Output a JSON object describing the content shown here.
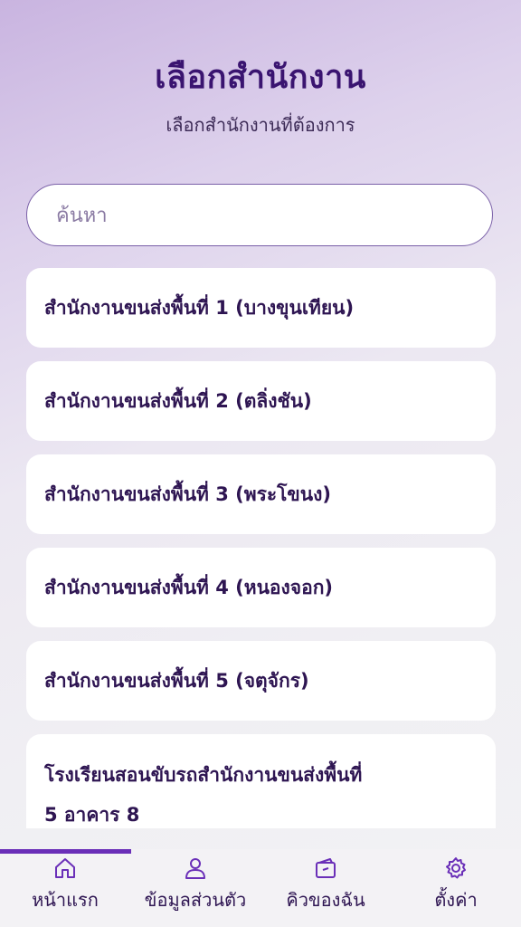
{
  "header": {
    "title": "เลือกสำนักงาน",
    "subtitle": "เลือกสำนักงานที่ต้องการ"
  },
  "search": {
    "placeholder": "ค้นหา",
    "value": ""
  },
  "offices": [
    {
      "label": "สำนักงานขนส่งพื้นที่ 1 (บางขุนเทียน)"
    },
    {
      "label": "สำนักงานขนส่งพื้นที่ 2 (ตลิ่งชัน)"
    },
    {
      "label": "สำนักงานขนส่งพื้นที่ 3 (พระโขนง)"
    },
    {
      "label": "สำนักงานขนส่งพื้นที่ 4 (หนองจอก)"
    },
    {
      "label": "สำนักงานขนส่งพื้นที่ 5 (จตุจักร)"
    },
    {
      "label_line1": "โรงเรียนสอนขับรถสำนักงานขนส่งพื้นที่",
      "label_line2": "5 อาคาร 8"
    }
  ],
  "nav": {
    "items": [
      {
        "label": "หน้าแรก",
        "icon": "home-icon",
        "active": true
      },
      {
        "label": "ข้อมูลส่วนตัว",
        "icon": "user-icon",
        "active": false
      },
      {
        "label": "คิวของฉัน",
        "icon": "ticket-icon",
        "active": false
      },
      {
        "label": "ตั้งค่า",
        "icon": "gear-icon",
        "active": false
      }
    ]
  },
  "colors": {
    "accent": "#6a2fb8",
    "text_dark": "#2e1552",
    "title": "#3a1470"
  }
}
